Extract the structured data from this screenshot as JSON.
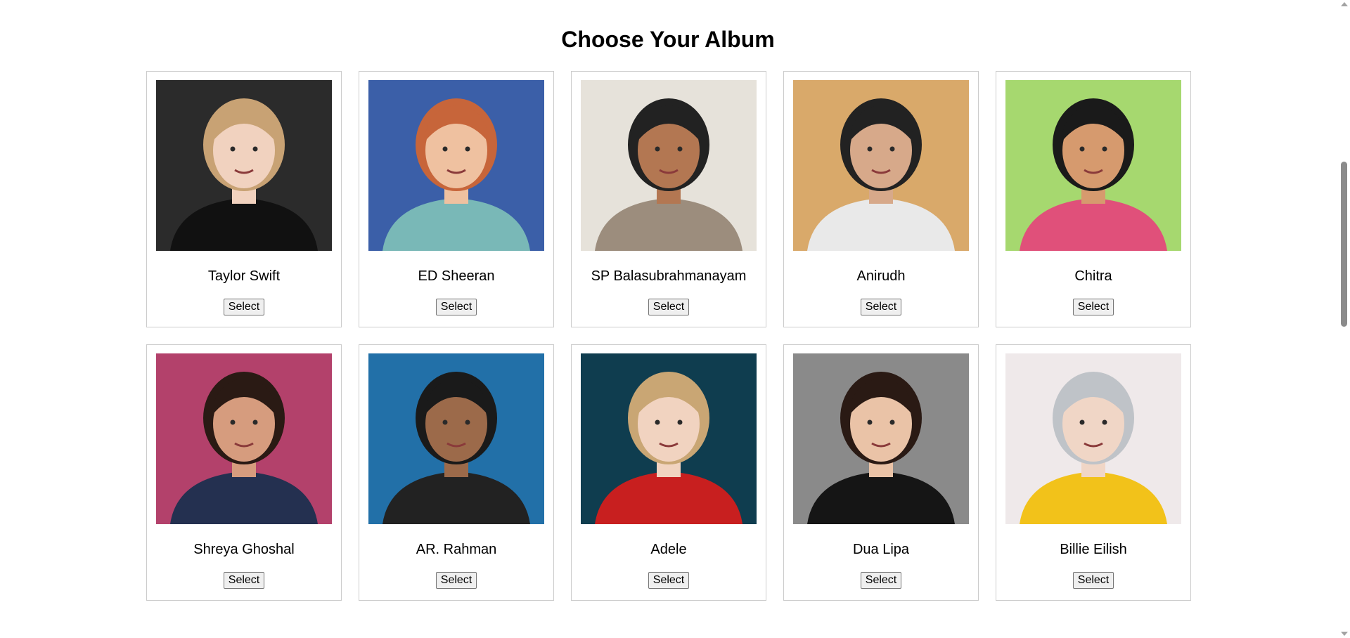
{
  "heading": "Choose Your Album",
  "button_label": "Select",
  "artists": [
    {
      "name": "Taylor Swift",
      "icon": "portrait-icon",
      "bg": "#2b2b2b",
      "accent": "#c8a274",
      "skin": "#f1d2bf",
      "top": "#111111"
    },
    {
      "name": "ED Sheeran",
      "icon": "portrait-icon",
      "bg": "#3b5fa8",
      "accent": "#c7653a",
      "skin": "#efc1a0",
      "top": "#79b8b7"
    },
    {
      "name": "SP Balasubrahmanayam",
      "icon": "portrait-icon",
      "bg": "#e6e2da",
      "accent": "#222222",
      "skin": "#b37752",
      "top": "#9c8d7d"
    },
    {
      "name": "Anirudh",
      "icon": "portrait-icon",
      "bg": "#d9a96a",
      "accent": "#222222",
      "skin": "#d7a98a",
      "top": "#e9e9e9"
    },
    {
      "name": "Chitra",
      "icon": "portrait-icon",
      "bg": "#a6d86f",
      "accent": "#1a1a1a",
      "skin": "#d69a6e",
      "top": "#e0507a"
    },
    {
      "name": "Shreya Ghoshal",
      "icon": "portrait-icon",
      "bg": "#b3416b",
      "accent": "#2a1a14",
      "skin": "#d69c7e",
      "top": "#243050"
    },
    {
      "name": "AR. Rahman",
      "icon": "portrait-icon",
      "bg": "#2270a8",
      "accent": "#1a1a1a",
      "skin": "#9c6a4a",
      "top": "#222222"
    },
    {
      "name": "Adele",
      "icon": "portrait-icon",
      "bg": "#0f3d4f",
      "accent": "#c9a674",
      "skin": "#f1d3c0",
      "top": "#c81f1f"
    },
    {
      "name": "Dua Lipa",
      "icon": "portrait-icon",
      "bg": "#8a8a8a",
      "accent": "#2a1a14",
      "skin": "#eac3a7",
      "top": "#151515"
    },
    {
      "name": "Billie Eilish",
      "icon": "portrait-icon",
      "bg": "#efe9ea",
      "accent": "#bfc3c8",
      "skin": "#f0d6c6",
      "top": "#f2c21a"
    }
  ]
}
